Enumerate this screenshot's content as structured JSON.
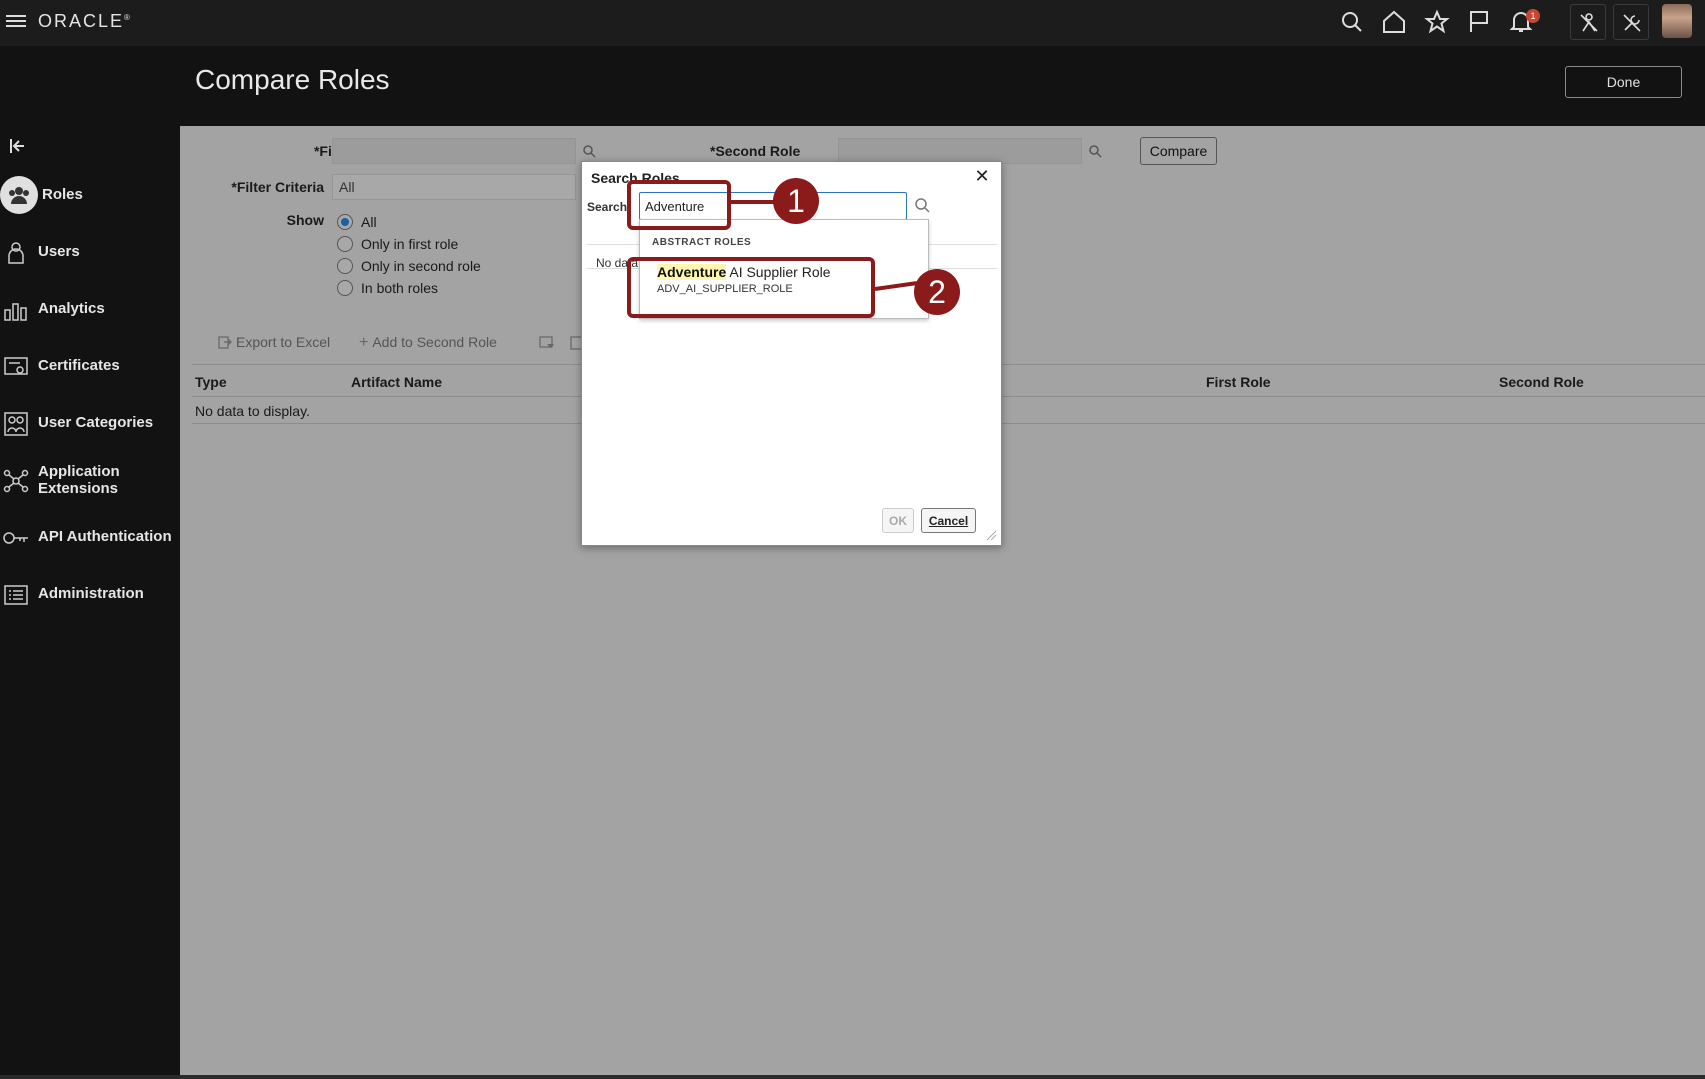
{
  "topbar": {
    "logo": "ORACLE",
    "notification_count": "1"
  },
  "page": {
    "title": "Compare Roles",
    "done_label": "Done"
  },
  "sidebar": {
    "items": [
      {
        "label": "Roles",
        "icon": "roles-icon",
        "active": true
      },
      {
        "label": "Users",
        "icon": "users-icon"
      },
      {
        "label": "Analytics",
        "icon": "analytics-icon"
      },
      {
        "label": "Certificates",
        "icon": "certificates-icon"
      },
      {
        "label": "User Categories",
        "icon": "user-categories-icon"
      },
      {
        "label": "Application Extensions",
        "icon": "application-extensions-icon"
      },
      {
        "label": "API Authentication",
        "icon": "api-authentication-icon"
      },
      {
        "label": "Administration",
        "icon": "administration-icon"
      }
    ]
  },
  "form": {
    "first_role_label": "First Role",
    "second_role_label": "Second Role",
    "filter_criteria_label": "Filter Criteria",
    "filter_criteria_value": "All",
    "compare_label": "Compare",
    "show_label": "Show",
    "show_options": [
      "All",
      "Only in first role",
      "Only in second role",
      "In both roles"
    ],
    "show_selected": "All",
    "required_marker": "*"
  },
  "toolbar": {
    "export_label": "Export to Excel",
    "add_label": "Add to Second Role"
  },
  "table": {
    "columns": [
      "Type",
      "Artifact Name",
      "First Role",
      "Second Role"
    ],
    "empty_text": "No data to display."
  },
  "dialog": {
    "title": "Search Roles",
    "search_label": "Search",
    "search_value": "Adventure",
    "no_data_text": "No data",
    "ok_label": "OK",
    "cancel_label": "Cancel"
  },
  "dropdown": {
    "section_header": "ABSTRACT ROLES",
    "items": [
      {
        "match": "Adventure",
        "rest": " AI Supplier Role",
        "code": "ADV_AI_SUPPLIER_ROLE"
      }
    ]
  },
  "callouts": [
    "1",
    "2"
  ],
  "colors": {
    "accent": "#8b1a1a",
    "topbar": "#1c1c1c",
    "content_overlay": "#a3a3a3",
    "badge": "#c74634"
  }
}
